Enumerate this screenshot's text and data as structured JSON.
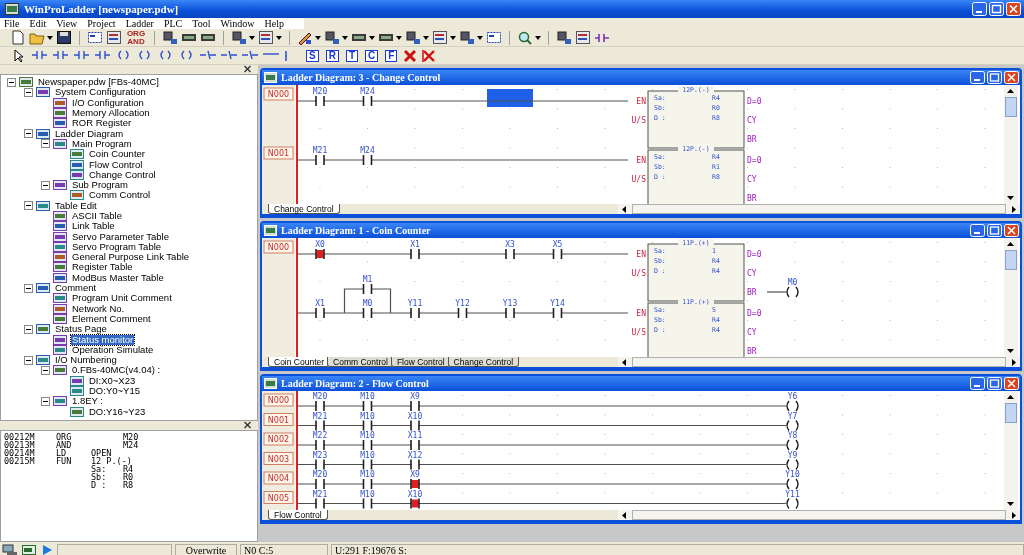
{
  "app": {
    "title": "WinProLadder [newspaper.pdw]"
  },
  "menu": [
    "File",
    "Edit",
    "View",
    "Project",
    "Ladder",
    "PLC",
    "Tool",
    "Window",
    "Help"
  ],
  "toolbar": {
    "org_and": [
      "ORG",
      "AND"
    ],
    "letter_buttons": [
      "S",
      "R",
      "T",
      "C",
      "F"
    ]
  },
  "project_tree": [
    {
      "label": "Newspaper.pdw [FBs-40MC]",
      "expanded": true,
      "selected": false,
      "children": [
        {
          "label": "System Configuration",
          "expanded": true,
          "selected": false,
          "children": [
            {
              "label": "I/O Configuration",
              "selected": false
            },
            {
              "label": "Memory Allocation",
              "selected": false
            },
            {
              "label": "ROR Register",
              "selected": false
            }
          ]
        },
        {
          "label": "Ladder Diagram",
          "expanded": true,
          "selected": false,
          "children": [
            {
              "label": "Main Program",
              "expanded": true,
              "selected": false,
              "children": [
                {
                  "label": "Coin Counter",
                  "selected": false
                },
                {
                  "label": "Flow Control",
                  "selected": false
                },
                {
                  "label": "Change Control",
                  "selected": false
                }
              ]
            },
            {
              "label": "Sub Program",
              "expanded": true,
              "selected": false,
              "children": [
                {
                  "label": "Comm Control",
                  "selected": false
                }
              ]
            }
          ]
        },
        {
          "label": "Table Edit",
          "expanded": true,
          "selected": false,
          "children": [
            {
              "label": "ASCII Table",
              "selected": false
            },
            {
              "label": "Link Table",
              "selected": false
            },
            {
              "label": "Servo Parameter Table",
              "selected": false
            },
            {
              "label": "Servo Program Table",
              "selected": false
            },
            {
              "label": "General Purpose Link Table",
              "selected": false
            },
            {
              "label": "Register Table",
              "selected": false
            },
            {
              "label": "ModBus Master Table",
              "selected": false
            }
          ]
        },
        {
          "label": "Comment",
          "expanded": true,
          "selected": false,
          "children": [
            {
              "label": "Program Unit Comment",
              "selected": false
            },
            {
              "label": "Network No.",
              "selected": false
            },
            {
              "label": "Element Comment",
              "selected": false
            }
          ]
        },
        {
          "label": "Status Page",
          "expanded": true,
          "selected": false,
          "children": [
            {
              "label": "Status monitor",
              "selected": true
            },
            {
              "label": "Operation Simulate",
              "selected": false
            }
          ]
        },
        {
          "label": "I/O Numbering",
          "expanded": true,
          "selected": false,
          "children": [
            {
              "label": "0.FBs-40MC(v4.04) :",
              "expanded": true,
              "selected": false,
              "children": [
                {
                  "label": "DI:X0~X23",
                  "selected": false
                },
                {
                  "label": "DO:Y0~Y15",
                  "selected": false
                }
              ]
            },
            {
              "label": "1.8EY :",
              "expanded": true,
              "selected": false,
              "children": [
                {
                  "label": "DO:Y16~Y23",
                  "selected": false
                }
              ]
            }
          ]
        }
      ]
    }
  ],
  "listing": [
    {
      "address": "00212M",
      "instruction": "ORG",
      "arg2": "M20"
    },
    {
      "address": "00213M",
      "instruction": "AND",
      "arg2": "M24"
    },
    {
      "address": "00214M",
      "instruction": "LD",
      "arg1": "OPEN"
    },
    {
      "address": "00215M",
      "instruction": "FUN",
      "arg1": "12 P.(-)"
    },
    {
      "arg1": "Sa:",
      "arg2": "R4"
    },
    {
      "arg1": "Sb:",
      "arg2": "R0"
    },
    {
      "arg1": "D :",
      "arg2": "R8"
    }
  ],
  "windows": [
    {
      "title": "Ladder Diagram: 3 - Change Control",
      "tabs": [
        {
          "label": "Change Control",
          "selected": true
        }
      ],
      "networks": [
        {
          "label": "N000",
          "rungs": [
            {
              "cells": [
                {
                  "kind": "contact",
                  "label": "M20",
                  "on": false
                },
                {
                  "kind": "contact",
                  "label": "M24",
                  "on": false
                },
                {
                  "kind": "wire"
                },
                {
                  "kind": "wire"
                },
                {
                  "kind": "wire",
                  "selected": true
                }
              ],
              "block": {
                "title": "12P.(-)",
                "inputs": [
                  "EN",
                  "U/S"
                ],
                "operands": [
                  {
                    "name": "Sa:",
                    "value": "R4"
                  },
                  {
                    "name": "Sb:",
                    "value": "R0"
                  },
                  {
                    "name": "D :",
                    "value": "R8"
                  }
                ],
                "outputs": [
                  {
                    "label": "D=0"
                  },
                  {
                    "label": "CY"
                  },
                  {
                    "label": "BR"
                  }
                ]
              }
            }
          ]
        },
        {
          "label": "N001",
          "rungs": [
            {
              "cells": [
                {
                  "kind": "contact",
                  "label": "M21",
                  "on": false
                },
                {
                  "kind": "contact",
                  "label": "M24",
                  "on": false
                }
              ],
              "block": {
                "title": "12P.(-)",
                "inputs": [
                  "EN",
                  "U/S"
                ],
                "operands": [
                  {
                    "name": "Sa:",
                    "value": "R4"
                  },
                  {
                    "name": "Sb:",
                    "value": "R1"
                  },
                  {
                    "name": "D :",
                    "value": "R8"
                  }
                ],
                "outputs": [
                  {
                    "label": "D=0"
                  },
                  {
                    "label": "CY"
                  },
                  {
                    "label": "BR"
                  }
                ]
              }
            }
          ]
        }
      ]
    },
    {
      "title": "Ladder Diagram: 1 - Coin Counter",
      "tabs": [
        {
          "label": "Coin Counter",
          "selected": true
        },
        {
          "label": "Comm Control",
          "selected": false
        },
        {
          "label": "Flow Control",
          "selected": false
        },
        {
          "label": "Change Control",
          "selected": false
        }
      ],
      "networks": [
        {
          "label": "N000",
          "rungs": [
            {
              "cells": [
                {
                  "kind": "contact",
                  "label": "X0",
                  "on": true
                },
                {
                  "kind": "wire"
                },
                {
                  "kind": "contact",
                  "label": "X1",
                  "on": false
                },
                {
                  "kind": "wire"
                },
                {
                  "kind": "contact",
                  "label": "X3",
                  "on": false
                },
                {
                  "kind": "contact",
                  "label": "X5",
                  "on": false
                }
              ],
              "block": {
                "title": "11P.(+)",
                "inputs": [
                  "EN",
                  "U/S"
                ],
                "operands": [
                  {
                    "name": "Sa:",
                    "value": "1"
                  },
                  {
                    "name": "Sb:",
                    "value": "R4"
                  },
                  {
                    "name": "D :",
                    "value": "R4"
                  }
                ],
                "outputs": [
                  {
                    "label": "D=0"
                  },
                  {
                    "label": "CY"
                  },
                  {
                    "label": "BR",
                    "coil": "M0"
                  }
                ]
              }
            },
            {
              "cells": [
                {
                  "kind": "contact",
                  "label": "X1",
                  "on": false
                },
                {
                  "kind": "contact",
                  "label": "M0",
                  "on": false,
                  "branch": {
                    "label": "M1",
                    "on": false
                  }
                },
                {
                  "kind": "contact",
                  "label": "Y11",
                  "on": false
                },
                {
                  "kind": "contact",
                  "label": "Y12",
                  "on": false
                },
                {
                  "kind": "contact",
                  "label": "Y13",
                  "on": false
                },
                {
                  "kind": "contact",
                  "label": "Y14",
                  "on": false
                }
              ],
              "block": {
                "title": "11P.(+)",
                "inputs": [
                  "EN",
                  "U/S"
                ],
                "operands": [
                  {
                    "name": "Sa:",
                    "value": "5"
                  },
                  {
                    "name": "Sb:",
                    "value": "R4"
                  },
                  {
                    "name": "D :",
                    "value": "R4"
                  }
                ],
                "outputs": [
                  {
                    "label": "D=0"
                  },
                  {
                    "label": "CY"
                  },
                  {
                    "label": "BR"
                  }
                ]
              }
            }
          ]
        }
      ]
    },
    {
      "title": "Ladder Diagram: 2 - Flow Control",
      "tabs": [
        {
          "label": "Flow Control",
          "selected": true
        }
      ],
      "networks": [
        {
          "label": "N000",
          "rungs": [
            {
              "cells": [
                {
                  "kind": "contact",
                  "label": "M20",
                  "on": false
                },
                {
                  "kind": "contact",
                  "label": "M10",
                  "on": false
                },
                {
                  "kind": "contact",
                  "label": "X9",
                  "on": false
                }
              ],
              "coil": {
                "label": "Y6"
              }
            }
          ]
        },
        {
          "label": "N001",
          "rungs": [
            {
              "cells": [
                {
                  "kind": "contact",
                  "label": "M21",
                  "on": false
                },
                {
                  "kind": "contact",
                  "label": "M10",
                  "on": false
                },
                {
                  "kind": "contact",
                  "label": "X10",
                  "on": false
                }
              ],
              "coil": {
                "label": "Y7"
              }
            }
          ]
        },
        {
          "label": "N002",
          "rungs": [
            {
              "cells": [
                {
                  "kind": "contact",
                  "label": "M22",
                  "on": false
                },
                {
                  "kind": "contact",
                  "label": "M10",
                  "on": false
                },
                {
                  "kind": "contact",
                  "label": "X11",
                  "on": false
                }
              ],
              "coil": {
                "label": "Y8"
              }
            }
          ]
        },
        {
          "label": "N003",
          "rungs": [
            {
              "cells": [
                {
                  "kind": "contact",
                  "label": "M23",
                  "on": false
                },
                {
                  "kind": "contact",
                  "label": "M10",
                  "on": false
                },
                {
                  "kind": "contact",
                  "label": "X12",
                  "on": false
                }
              ],
              "coil": {
                "label": "Y9"
              }
            }
          ]
        },
        {
          "label": "N004",
          "rungs": [
            {
              "cells": [
                {
                  "kind": "contact",
                  "label": "M20",
                  "on": false
                },
                {
                  "kind": "contact",
                  "label": "M10",
                  "on": false
                },
                {
                  "kind": "contact",
                  "label": "X9",
                  "on": true
                }
              ],
              "coil": {
                "label": "Y10"
              }
            }
          ]
        },
        {
          "label": "N005",
          "rungs": [
            {
              "cells": [
                {
                  "kind": "contact",
                  "label": "M21",
                  "on": false
                },
                {
                  "kind": "contact",
                  "label": "M10",
                  "on": false
                },
                {
                  "kind": "contact",
                  "label": "X10",
                  "on": true
                }
              ],
              "coil": {
                "label": "Y11"
              }
            }
          ]
        }
      ]
    }
  ],
  "status_bar": {
    "mode": "Overwrite",
    "position": "N0 C:5",
    "memory": "U:291 F:19676 S:"
  }
}
